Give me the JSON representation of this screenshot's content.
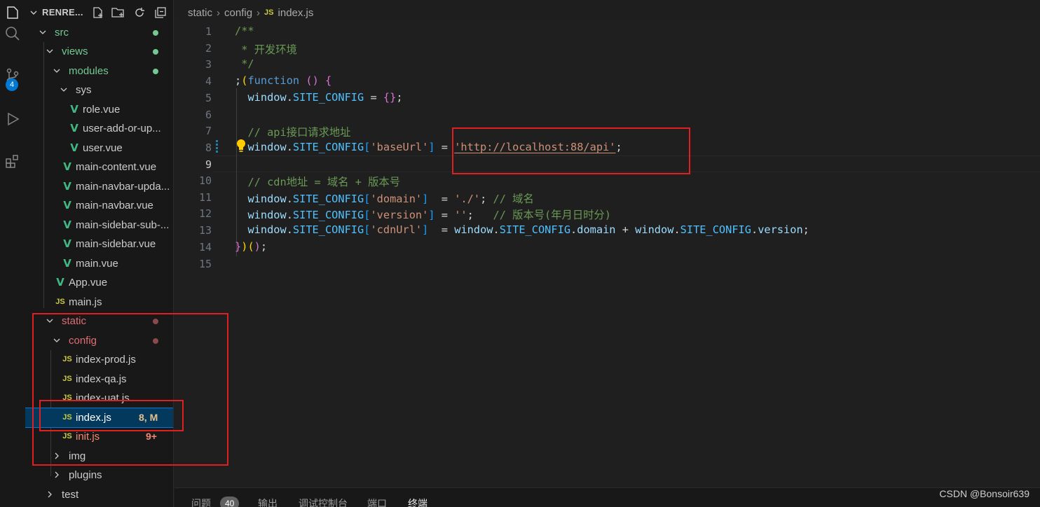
{
  "activity_bar": {
    "icons": [
      "files-icon",
      "search-icon",
      "source-control-icon",
      "run-debug-icon",
      "extensions-icon"
    ],
    "source_control_badge": "4"
  },
  "explorer": {
    "title": "RENRE...",
    "actions": [
      "new-file-icon",
      "new-folder-icon",
      "refresh-icon",
      "collapse-all-icon"
    ],
    "items": [
      {
        "label": "src",
        "type": "folder",
        "open": true,
        "color": "#73c991"
      },
      {
        "label": "views",
        "type": "folder",
        "open": true,
        "color": "#73c991"
      },
      {
        "label": "modules",
        "type": "folder",
        "open": true,
        "color": "#73c991"
      },
      {
        "label": "sys",
        "type": "folder",
        "open": true,
        "color": "#cccccc"
      },
      {
        "label": "role.vue",
        "type": "vue"
      },
      {
        "label": "user-add-or-up...",
        "type": "vue"
      },
      {
        "label": "user.vue",
        "type": "vue"
      },
      {
        "label": "main-content.vue",
        "type": "vue"
      },
      {
        "label": "main-navbar-upda...",
        "type": "vue"
      },
      {
        "label": "main-navbar.vue",
        "type": "vue"
      },
      {
        "label": "main-sidebar-sub-...",
        "type": "vue"
      },
      {
        "label": "main-sidebar.vue",
        "type": "vue"
      },
      {
        "label": "main.vue",
        "type": "vue"
      },
      {
        "label": "App.vue",
        "type": "vue"
      },
      {
        "label": "main.js",
        "type": "js"
      },
      {
        "label": "static",
        "type": "folder",
        "open": true,
        "color": "#e06c75"
      },
      {
        "label": "config",
        "type": "folder",
        "open": true,
        "color": "#e06c75"
      },
      {
        "label": "index-prod.js",
        "type": "js"
      },
      {
        "label": "index-qa.js",
        "type": "js"
      },
      {
        "label": "index-uat.js",
        "type": "js"
      },
      {
        "label": "index.js",
        "type": "js",
        "status": "8, M"
      },
      {
        "label": "init.js",
        "type": "js",
        "status": "9+",
        "color": "#f48771"
      },
      {
        "label": "img",
        "type": "folder",
        "open": false
      },
      {
        "label": "plugins",
        "type": "folder",
        "open": false
      },
      {
        "label": "test",
        "type": "folder",
        "open": false
      }
    ]
  },
  "breadcrumb": {
    "parts": [
      "static",
      "config",
      "index.js"
    ],
    "file_icon": "JS"
  },
  "editor": {
    "active_line": 9,
    "line_numbers": [
      "1",
      "2",
      "3",
      "4",
      "5",
      "6",
      "7",
      "8",
      "9",
      "10",
      "11",
      "12",
      "13",
      "14",
      "15"
    ],
    "lines": [
      "/**",
      " * 开发环境",
      " */",
      ";(function () {",
      "  window.SITE_CONFIG = {};",
      "",
      "  // api接口请求地址",
      "  window.SITE_CONFIG['baseUrl'] = 'http://localhost:88/api';",
      "",
      "  // cdn地址 = 域名 + 版本号",
      "  window.SITE_CONFIG['domain']  = './'; // 域名",
      "  window.SITE_CONFIG['version'] = '';   // 版本号(年月日时分)",
      "  window.SITE_CONFIG['cdnUrl']  = window.SITE_CONFIG.domain + window.SITE_CONFIG.version;",
      "})();",
      ""
    ]
  },
  "panel": {
    "tabs": [
      "问题",
      "输出",
      "调试控制台",
      "端口",
      "终端"
    ],
    "problems_count": "40",
    "active_tab": "终端"
  },
  "watermark": "CSDN @Bonsoir639",
  "colors": {
    "annotation_red": "#e02020",
    "selection_blue": "#04395e"
  }
}
